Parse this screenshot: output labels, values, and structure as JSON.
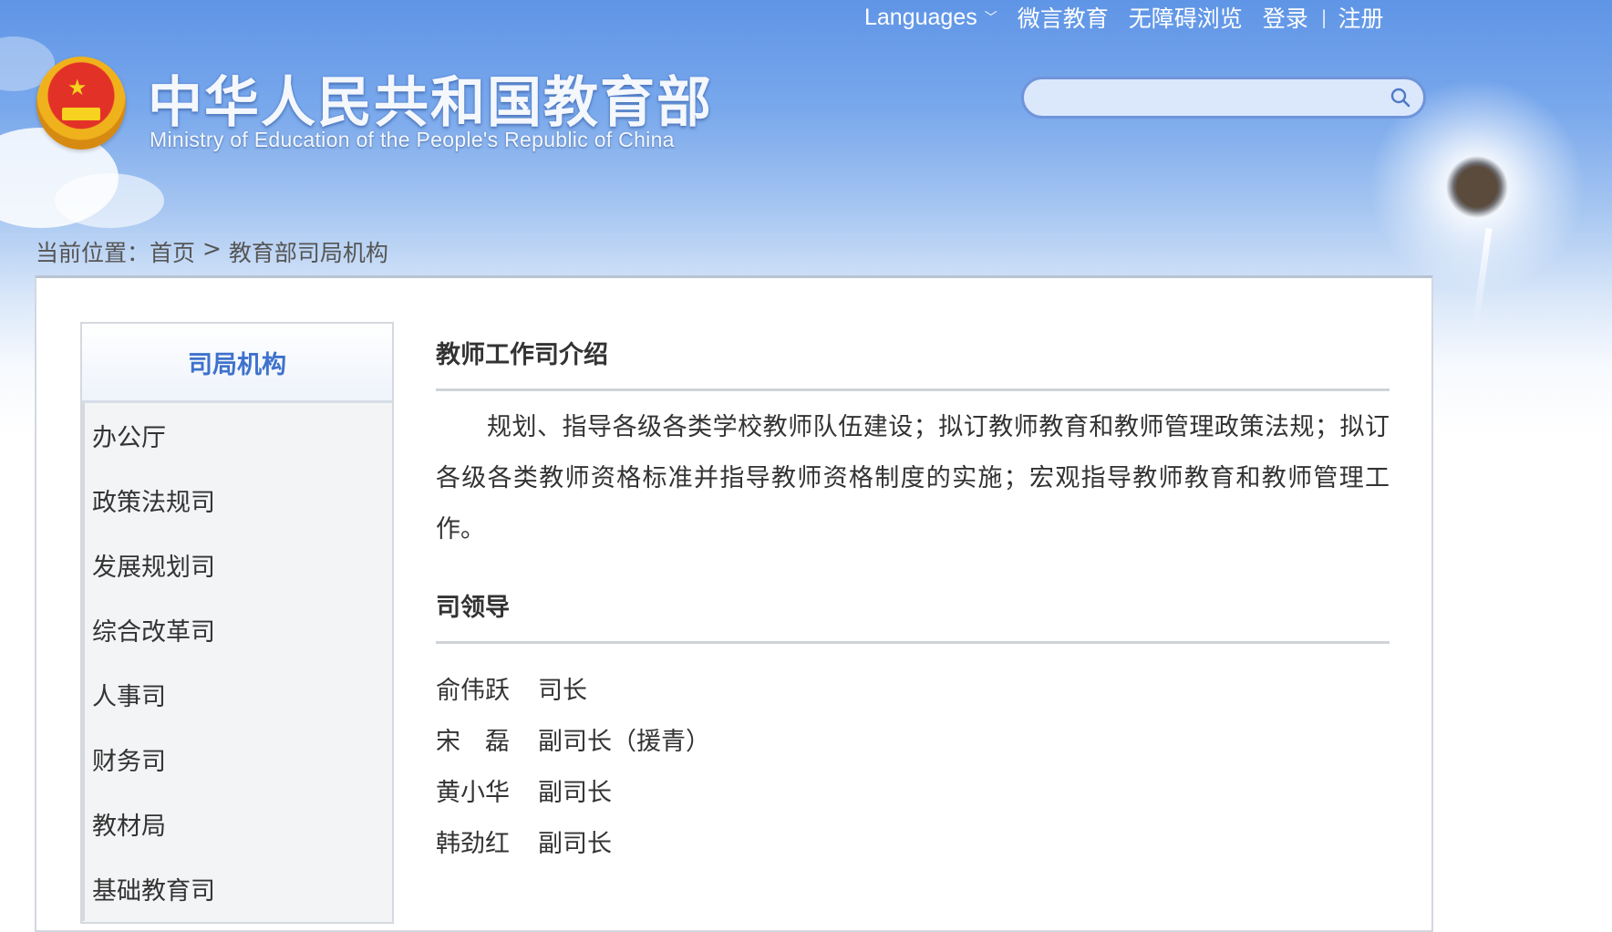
{
  "topnav": {
    "languages": "Languages",
    "weiyan": "微言教育",
    "accessible": "无障碍浏览",
    "login": "登录",
    "separator": "|",
    "register": "注册"
  },
  "brand": {
    "name_cn": "中华人民共和国教育部",
    "name_en": "Ministry of Education of the People's Republic of China"
  },
  "search": {
    "placeholder": ""
  },
  "breadcrumb": {
    "label": "当前位置：",
    "home": "首页",
    "sep": " > ",
    "current": "教育部司局机构"
  },
  "sidebar": {
    "title": "司局机构",
    "items": [
      {
        "label": "办公厅"
      },
      {
        "label": "政策法规司"
      },
      {
        "label": "发展规划司"
      },
      {
        "label": "综合改革司"
      },
      {
        "label": "人事司"
      },
      {
        "label": "财务司"
      },
      {
        "label": "教材局"
      },
      {
        "label": "基础教育司"
      }
    ]
  },
  "content": {
    "intro_title": "教师工作司介绍",
    "intro_text": "规划、指导各级各类学校教师队伍建设；拟订教师教育和教师管理政策法规；拟订各级各类教师资格标准并指导教师资格制度的实施；宏观指导教师教育和教师管理工作。",
    "leaders_title": "司领导",
    "leaders": [
      {
        "name": "俞伟跃",
        "title": "司长"
      },
      {
        "name": "宋　磊",
        "title": "副司长（援青）"
      },
      {
        "name": "黄小华",
        "title": "副司长"
      },
      {
        "name": "韩劲红",
        "title": "副司长"
      }
    ]
  },
  "colors": {
    "header_blue": "#6a9be8",
    "accent_text": "#3e72cc",
    "body_text": "#333333"
  },
  "icons": [
    "national-emblem-icon",
    "chevron-down-icon",
    "search-icon"
  ]
}
